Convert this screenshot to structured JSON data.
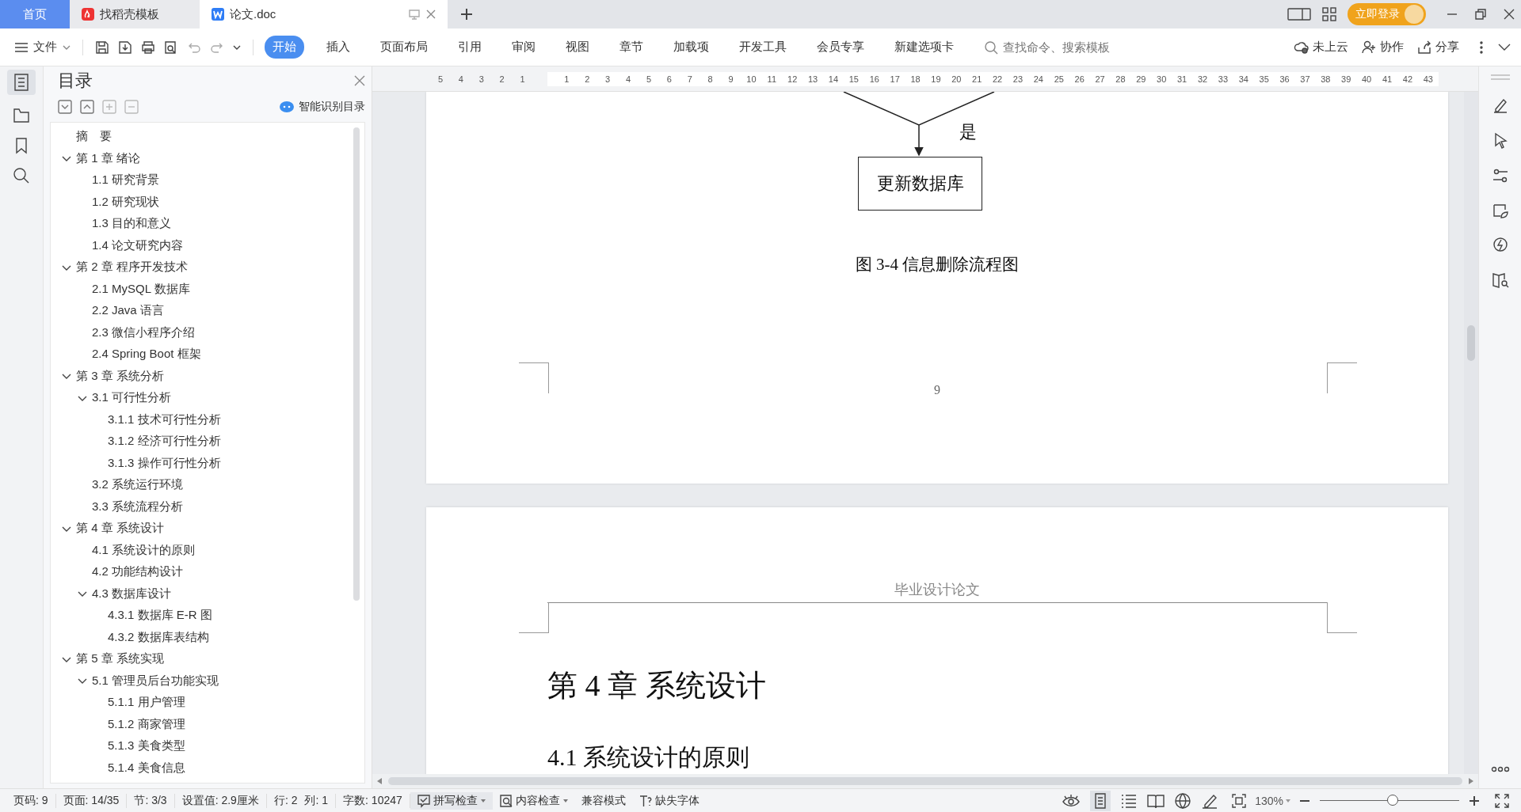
{
  "tabs": [
    {
      "label": "首页",
      "kind": "home",
      "selected": false
    },
    {
      "label": "找稻壳模板",
      "kind": "template",
      "selected": false
    },
    {
      "label": "论文.doc",
      "kind": "document",
      "selected": true
    }
  ],
  "title_bar": {
    "login_button": "立即登录"
  },
  "toolbar": {
    "file_menu": "文件",
    "ribbon_tabs": [
      {
        "label": "开始",
        "selected": true
      },
      {
        "label": "插入",
        "selected": false
      },
      {
        "label": "页面布局",
        "selected": false
      },
      {
        "label": "引用",
        "selected": false
      },
      {
        "label": "审阅",
        "selected": false
      },
      {
        "label": "视图",
        "selected": false
      },
      {
        "label": "章节",
        "selected": false
      },
      {
        "label": "加载项",
        "selected": false
      },
      {
        "label": "开发工具",
        "selected": false
      },
      {
        "label": "会员专享",
        "selected": false
      },
      {
        "label": "新建选项卡",
        "selected": false
      }
    ],
    "search": {
      "placeholder": "查找命令、搜索模板"
    },
    "actions": [
      {
        "label": "未上云",
        "kind": "cloud"
      },
      {
        "label": "协作",
        "kind": "collab"
      },
      {
        "label": "分享",
        "kind": "share"
      }
    ]
  },
  "ruler": {
    "left_ticks": [
      "5",
      "4",
      "3",
      "2",
      "1"
    ],
    "right_ticks": [
      "1",
      "2",
      "3",
      "4",
      "5",
      "6",
      "7",
      "8",
      "9",
      "10",
      "11",
      "12",
      "13",
      "14",
      "15",
      "16",
      "17",
      "18",
      "19",
      "20",
      "21",
      "22",
      "23",
      "24",
      "25",
      "26",
      "27",
      "28",
      "29",
      "30",
      "31",
      "32",
      "33",
      "34",
      "35",
      "36",
      "37",
      "38",
      "39",
      "40",
      "41",
      "42",
      "43"
    ]
  },
  "toc": {
    "title": "目录",
    "smart_button": "智能识别目录",
    "items": [
      {
        "label": "摘　要"
      },
      {
        "label": "第 1 章  绪论",
        "expanded": true,
        "children": [
          {
            "label": "1.1  研究背景"
          },
          {
            "label": "1.2  研究现状"
          },
          {
            "label": "1.3  目的和意义"
          },
          {
            "label": "1.4  论文研究内容"
          }
        ]
      },
      {
        "label": "第 2 章  程序开发技术",
        "expanded": true,
        "children": [
          {
            "label": "2.1 MySQL 数据库"
          },
          {
            "label": "2.2 Java 语言"
          },
          {
            "label": "2.3  微信小程序介绍"
          },
          {
            "label": "2.4 Spring Boot  框架"
          }
        ]
      },
      {
        "label": "第 3 章  系统分析",
        "expanded": true,
        "children": [
          {
            "label": "3.1 可行性分析",
            "expanded": true,
            "children": [
              {
                "label": "3.1.1 技术可行性分析"
              },
              {
                "label": "3.1.2 经济可行性分析"
              },
              {
                "label": "3.1.3 操作可行性分析"
              }
            ]
          },
          {
            "label": "3.2 系统运行环境"
          },
          {
            "label": "3.3 系统流程分析"
          }
        ]
      },
      {
        "label": "第 4 章  系统设计",
        "expanded": true,
        "children": [
          {
            "label": "4.1  系统设计的原则"
          },
          {
            "label": "4.2  功能结构设计"
          },
          {
            "label": "4.3  数据库设计",
            "expanded": true,
            "children": [
              {
                "label": "4.3.1  数据库 E-R 图"
              },
              {
                "label": "4.3.2  数据库表结构"
              }
            ]
          }
        ]
      },
      {
        "label": "第 5 章  系统实现",
        "expanded": true,
        "children": [
          {
            "label": "5.1 管理员后台功能实现",
            "expanded": true,
            "children": [
              {
                "label": "5.1.1  用户管理"
              },
              {
                "label": "5.1.2  商家管理"
              },
              {
                "label": "5.1.3  美食类型"
              },
              {
                "label": "5.1.4  美食信息"
              }
            ]
          }
        ]
      }
    ]
  },
  "document": {
    "flowchart": {
      "branch_label": "是",
      "box": "更新数据库"
    },
    "figure_caption": "图 3-4  信息删除流程图",
    "page_number": "9",
    "header": "毕业设计论文",
    "chapter_heading": "第 4 章  系统设计",
    "section_heading": "4.1  系统设计的原则"
  },
  "status_bar": {
    "items": [
      "页码: 9",
      "页面: 14/35",
      "节: 3/3",
      "设置值: 2.9厘米",
      "行: 2",
      "列: 1",
      "字数: 10247"
    ],
    "tools": [
      {
        "label": "拼写检查",
        "kind": "spell"
      },
      {
        "label": "内容检查",
        "kind": "content"
      },
      {
        "label": "兼容模式",
        "kind": "plain"
      },
      {
        "label": "缺失字体",
        "kind": "font"
      }
    ],
    "zoom": {
      "reading": "130%",
      "level": 0.52
    }
  }
}
